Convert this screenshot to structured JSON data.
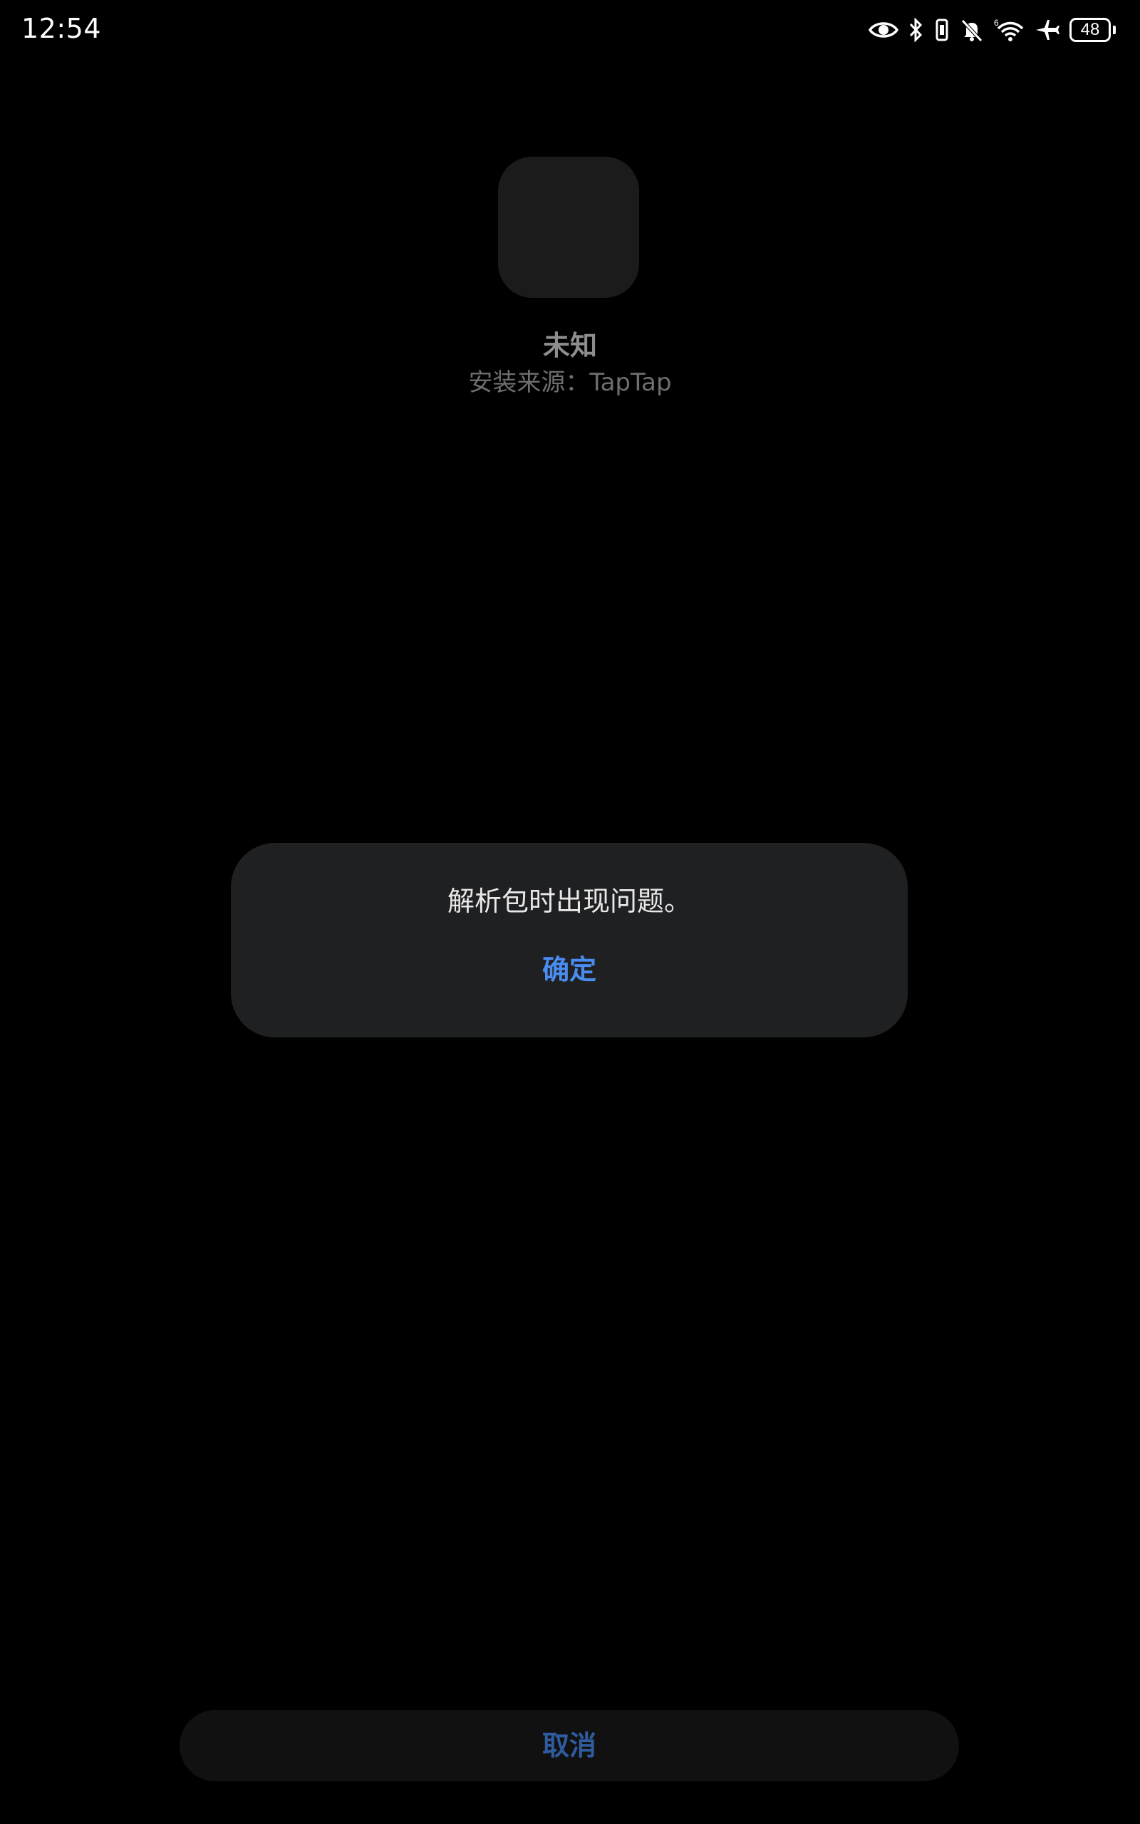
{
  "status_bar": {
    "time": "12:54",
    "battery_level": "48",
    "icons": [
      "eye-icon",
      "bluetooth-icon",
      "vibrate-icon",
      "mute-icon",
      "wifi-6-icon",
      "airplane-icon",
      "battery-icon"
    ]
  },
  "app": {
    "name": "未知",
    "install_source": "安装来源：TapTap"
  },
  "dialog": {
    "message": "解析包时出现问题。",
    "confirm_label": "确定"
  },
  "footer": {
    "cancel_label": "取消"
  },
  "colors": {
    "background": "#000000",
    "dialog_background": "#1f2022",
    "accent": "#4a8cf0",
    "accent_dim": "#2f5c9e"
  }
}
